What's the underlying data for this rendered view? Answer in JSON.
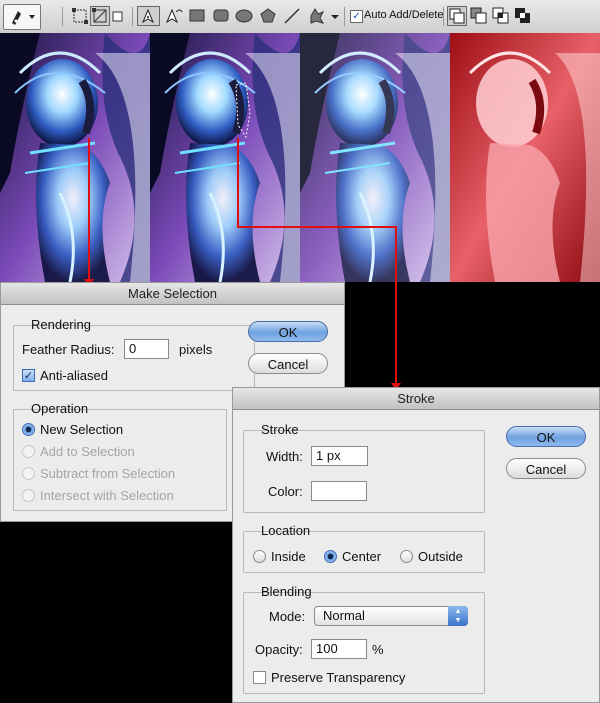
{
  "toolbar": {
    "auto_add_delete_label": "Auto Add/Delete",
    "auto_add_delete_checked": true
  },
  "make_selection": {
    "title": "Make Selection",
    "rendering_title": "Rendering",
    "feather_label": "Feather Radius:",
    "feather_value": "0",
    "feather_unit": "pixels",
    "anti_aliased_label": "Anti-aliased",
    "anti_aliased_checked": true,
    "operation_title": "Operation",
    "operations": [
      "New Selection",
      "Add to Selection",
      "Subtract from Selection",
      "Intersect with Selection"
    ],
    "ok_label": "OK",
    "cancel_label": "Cancel"
  },
  "stroke": {
    "title": "Stroke",
    "stroke_group_title": "Stroke",
    "width_label": "Width:",
    "width_value": "1 px",
    "color_label": "Color:",
    "color_value": "#ffffff",
    "location_title": "Location",
    "location_options": [
      "Inside",
      "Center",
      "Outside"
    ],
    "location_selected": "Center",
    "blending_title": "Blending",
    "mode_label": "Mode:",
    "mode_value": "Normal",
    "opacity_label": "Opacity:",
    "opacity_value": "100",
    "opacity_unit": "%",
    "preserve_label": "Preserve Transparency",
    "preserve_checked": false,
    "ok_label": "OK",
    "cancel_label": "Cancel"
  },
  "colors": {
    "arrow": "#e01010",
    "default_button": "#6fa2e0",
    "dialog_bg": "#ececec"
  }
}
